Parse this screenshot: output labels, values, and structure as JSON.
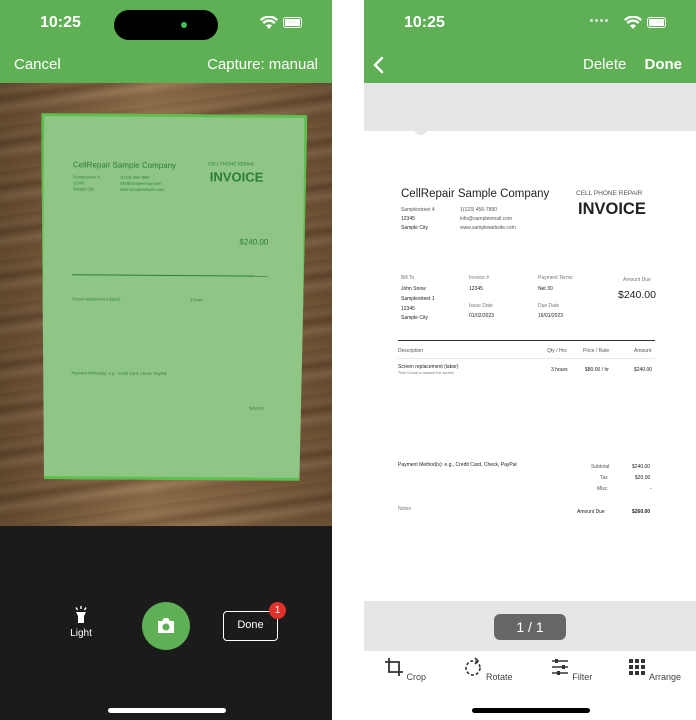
{
  "left": {
    "status": {
      "time": "10:25"
    },
    "nav": {
      "cancel": "Cancel",
      "capture": "Capture: manual"
    },
    "scan_preview": {
      "company": "CellRepair Sample Company",
      "doc_label": "CELL PHONE REPAIR",
      "doc_title": "INVOICE",
      "address1": "Samplestreet 4",
      "address2": "12345",
      "address3": "Sample City",
      "phone": "1(123) 456-7890",
      "email": "info@sampleemail.com",
      "web": "www.samplewebsite.com",
      "amount": "$240.00",
      "service": "Screen replacement (labor)",
      "hours": "3 hours",
      "payment": "Payment Method(s): e.g., Credit Card, Check, PayPal",
      "total": "$260.00"
    },
    "controls": {
      "light": "Light",
      "done": "Done",
      "badge_count": "1"
    }
  },
  "right": {
    "status": {
      "time": "10:25"
    },
    "nav": {
      "delete": "Delete",
      "done": "Done"
    },
    "invoice": {
      "company": "CellRepair Sample Company",
      "doc_label": "CELL PHONE REPAIR",
      "doc_title": "INVOICE",
      "address1": "Samplestreet 4",
      "address2": "12345",
      "address3": "Sample City",
      "phone": "1(123) 456-7890",
      "email": "info@sampleemail.com",
      "web": "www.samplewebsite.com",
      "bill_to_label": "Bill To",
      "bill_name": "John Snow",
      "bill_addr1": "Samplestreet 1",
      "bill_addr2": "12345",
      "bill_addr3": "Sample City",
      "invoice_no_label": "Invoice #",
      "invoice_no": "12345",
      "issue_date_label": "Issue Date",
      "issue_date": "01/02/2023",
      "terms_label": "Payment Terms",
      "terms": "Net 30",
      "due_date_label": "Due Date",
      "due_date": "16/01/2023",
      "amount_due_label": "Amount Due",
      "amount_due": "$240.00",
      "col_description": "Description",
      "col_qty": "Qty / Hrs",
      "col_price": "Price / Rate",
      "col_amount": "Amount",
      "item_title": "Screen replacement (labor)",
      "item_sub": "Time it took to replace the screen",
      "item_qty": "3 hours",
      "item_price": "$80.00 / hr",
      "item_amount": "$240.00",
      "payment_methods": "Payment Method(s): e.g., Credit Card, Check, PayPal",
      "subtotal_label": "Subtotal",
      "subtotal": "$240.00",
      "tax_label": "Tax",
      "tax": "$20.00",
      "misc_label": "Misc.",
      "misc": "-",
      "notes_label": "Notes",
      "total_label": "Amount Due",
      "total": "$260.00"
    },
    "pager": {
      "label": "1 / 1"
    },
    "tools": {
      "crop": "Crop",
      "rotate": "Rotate",
      "filter": "Filter",
      "arrange": "Arrange"
    }
  },
  "colors": {
    "accent": "#5fb055",
    "badge": "#e0322b"
  }
}
